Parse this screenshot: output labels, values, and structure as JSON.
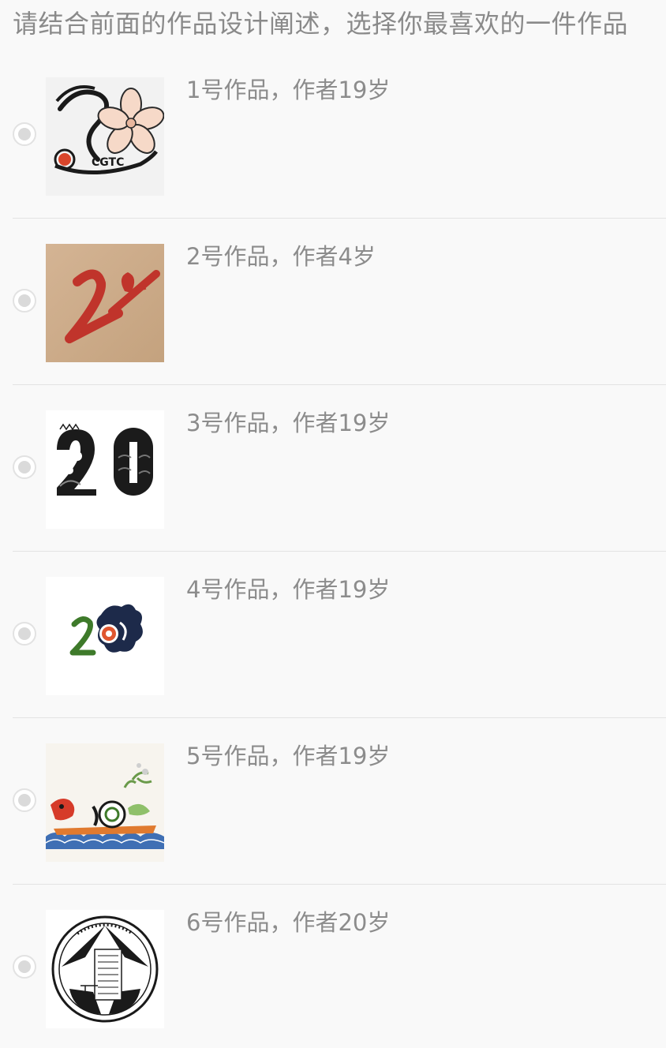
{
  "question": {
    "title": "请结合前面的作品设计阐述，选择你最喜欢的一件作品"
  },
  "options": [
    {
      "label": "1号作品，作者19岁",
      "selected": false
    },
    {
      "label": "2号作品，作者4岁",
      "selected": false
    },
    {
      "label": "3号作品，作者19岁",
      "selected": false
    },
    {
      "label": "4号作品，作者19岁",
      "selected": false
    },
    {
      "label": "5号作品，作者19岁",
      "selected": false
    },
    {
      "label": "6号作品，作者20岁",
      "selected": false
    }
  ],
  "artwork_text": {
    "work1_letters": "CGTC"
  },
  "colors": {
    "title_text": "#8a8a8a",
    "label_text": "#8c8c8c",
    "divider": "#e3e3e3",
    "radio_border": "#e2e2e2",
    "radio_dot": "#dadada",
    "background": "#f9f9f9"
  }
}
